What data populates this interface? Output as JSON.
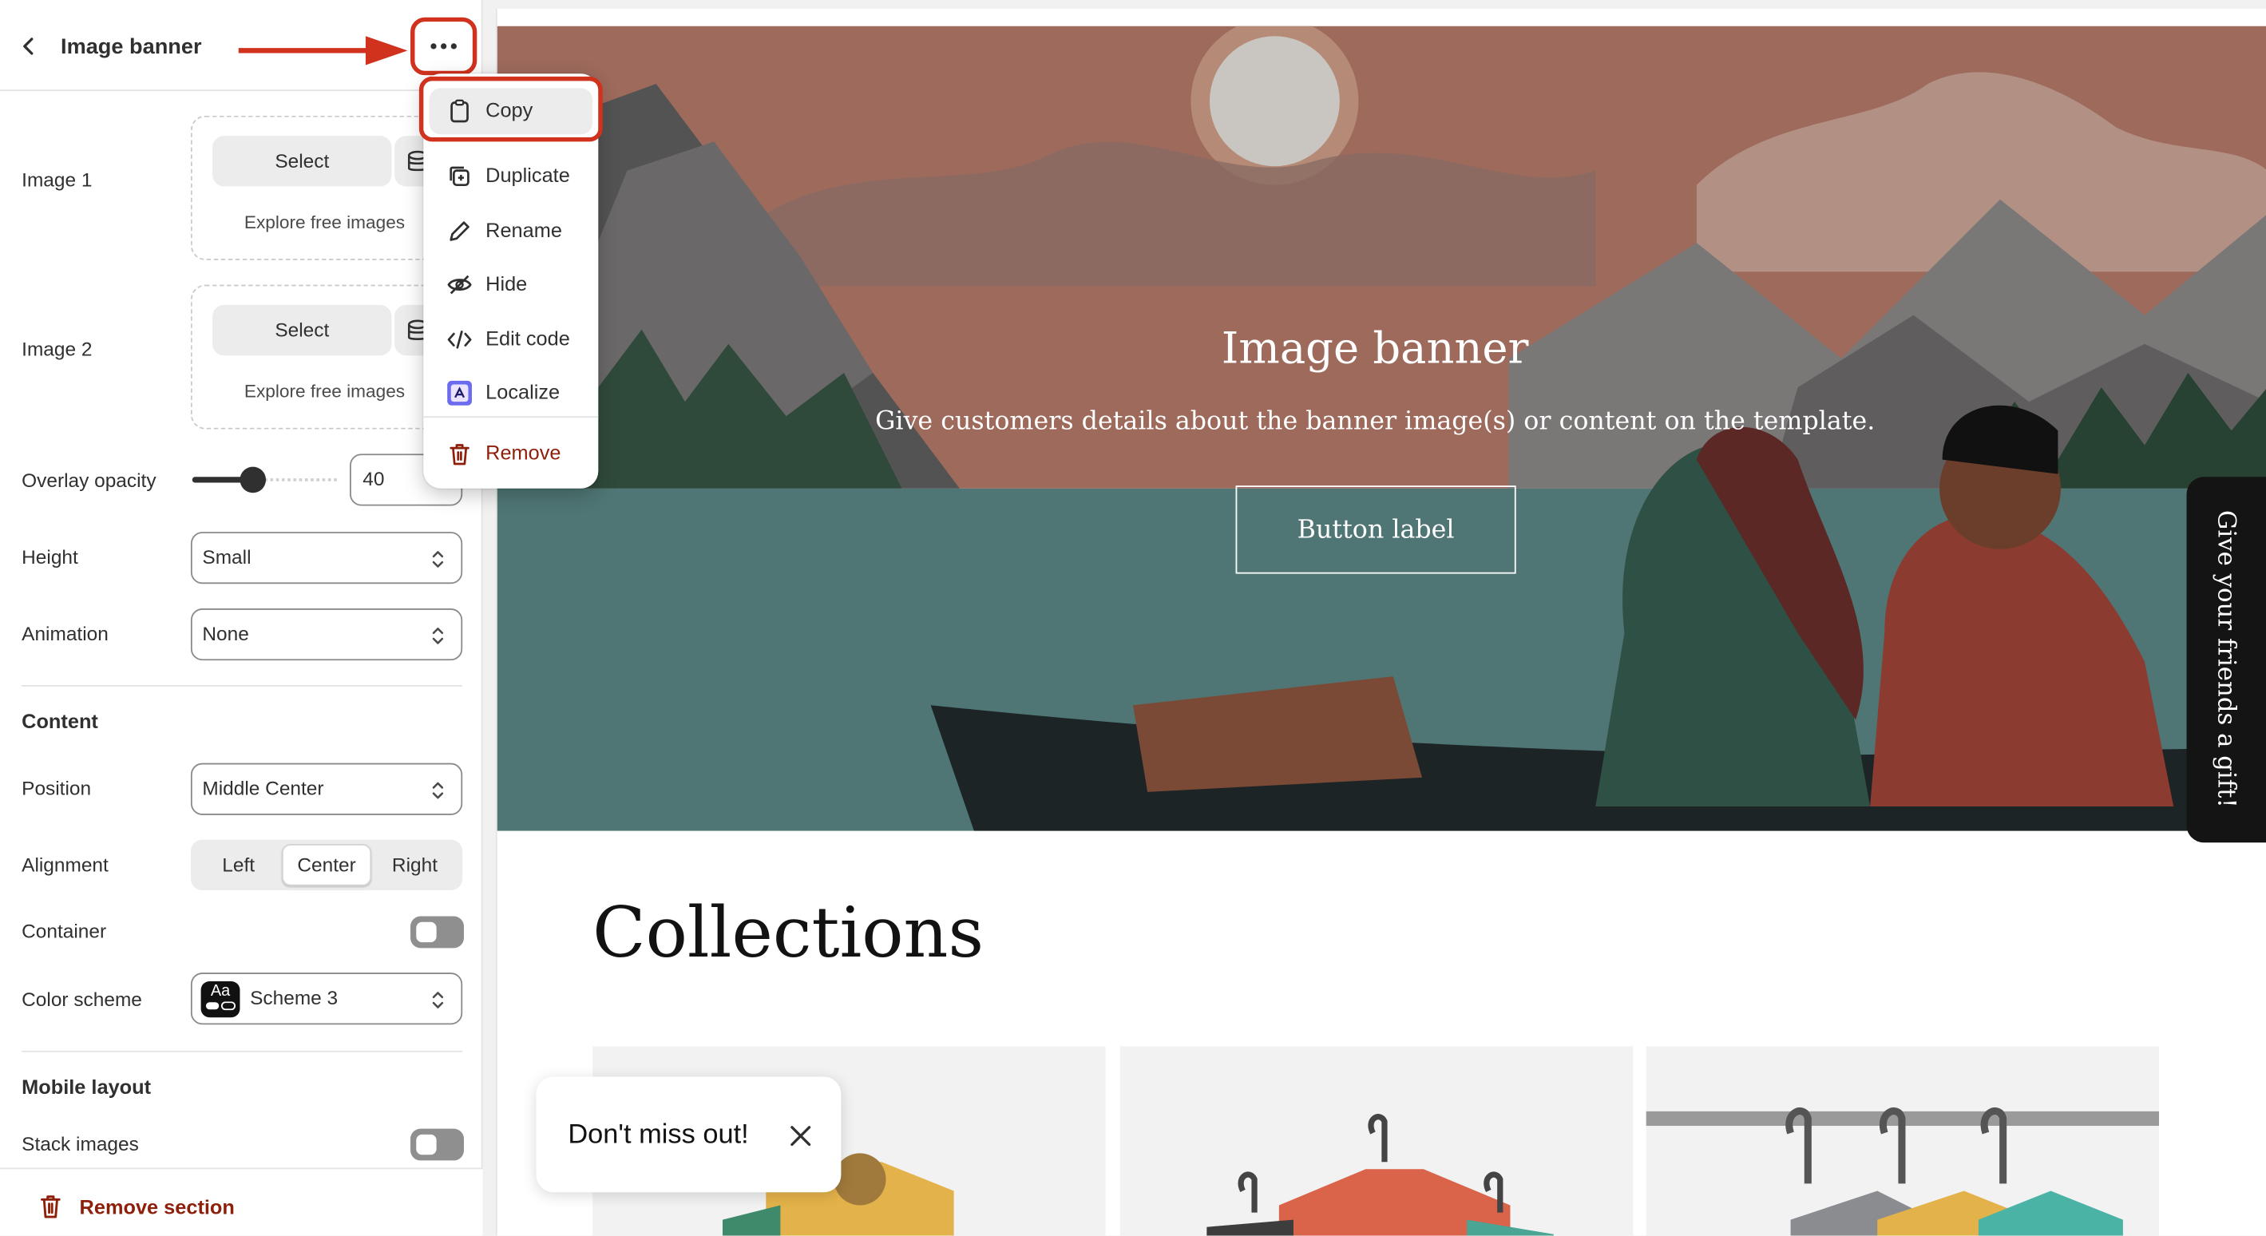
{
  "sidebar": {
    "title": "Image banner",
    "image1": {
      "label": "Image 1",
      "select_label": "Select",
      "explore_label": "Explore free images"
    },
    "image2": {
      "label": "Image 2",
      "select_label": "Select",
      "explore_label": "Explore free images"
    },
    "overlay": {
      "label": "Overlay opacity",
      "value": "40",
      "slider_value": 40
    },
    "height": {
      "label": "Height",
      "value": "Small"
    },
    "animation": {
      "label": "Animation",
      "value": "None"
    },
    "content_heading": "Content",
    "position": {
      "label": "Position",
      "value": "Middle Center"
    },
    "alignment": {
      "label": "Alignment",
      "options": [
        "Left",
        "Center",
        "Right"
      ],
      "selected": "Center"
    },
    "container": {
      "label": "Container",
      "on": false
    },
    "color_scheme": {
      "label": "Color scheme",
      "badge": "Aa",
      "value": "Scheme 3"
    },
    "mobile_heading": "Mobile layout",
    "stack_images": {
      "label": "Stack images",
      "on": false
    },
    "remove_section": "Remove section"
  },
  "menu": {
    "items": [
      {
        "label": "Copy",
        "icon": "clipboard-icon"
      },
      {
        "label": "Duplicate",
        "icon": "duplicate-icon"
      },
      {
        "label": "Rename",
        "icon": "pencil-icon"
      },
      {
        "label": "Hide",
        "icon": "eye-slash-icon"
      },
      {
        "label": "Edit code",
        "icon": "code-icon"
      },
      {
        "label": "Localize",
        "icon": "localize-icon"
      },
      {
        "label": "Remove",
        "icon": "trash-icon"
      }
    ]
  },
  "preview": {
    "banner": {
      "title": "Image banner",
      "subtitle": "Give customers details about the banner image(s) or content on the template.",
      "button_label": "Button label"
    },
    "gift_tab": "Give your friends a gift!",
    "collections_title": "Collections",
    "toast": {
      "text": "Don't miss out!"
    }
  },
  "colors": {
    "highlight": "#d0321e",
    "danger": "#8e1f0b",
    "ink": "#303030"
  }
}
